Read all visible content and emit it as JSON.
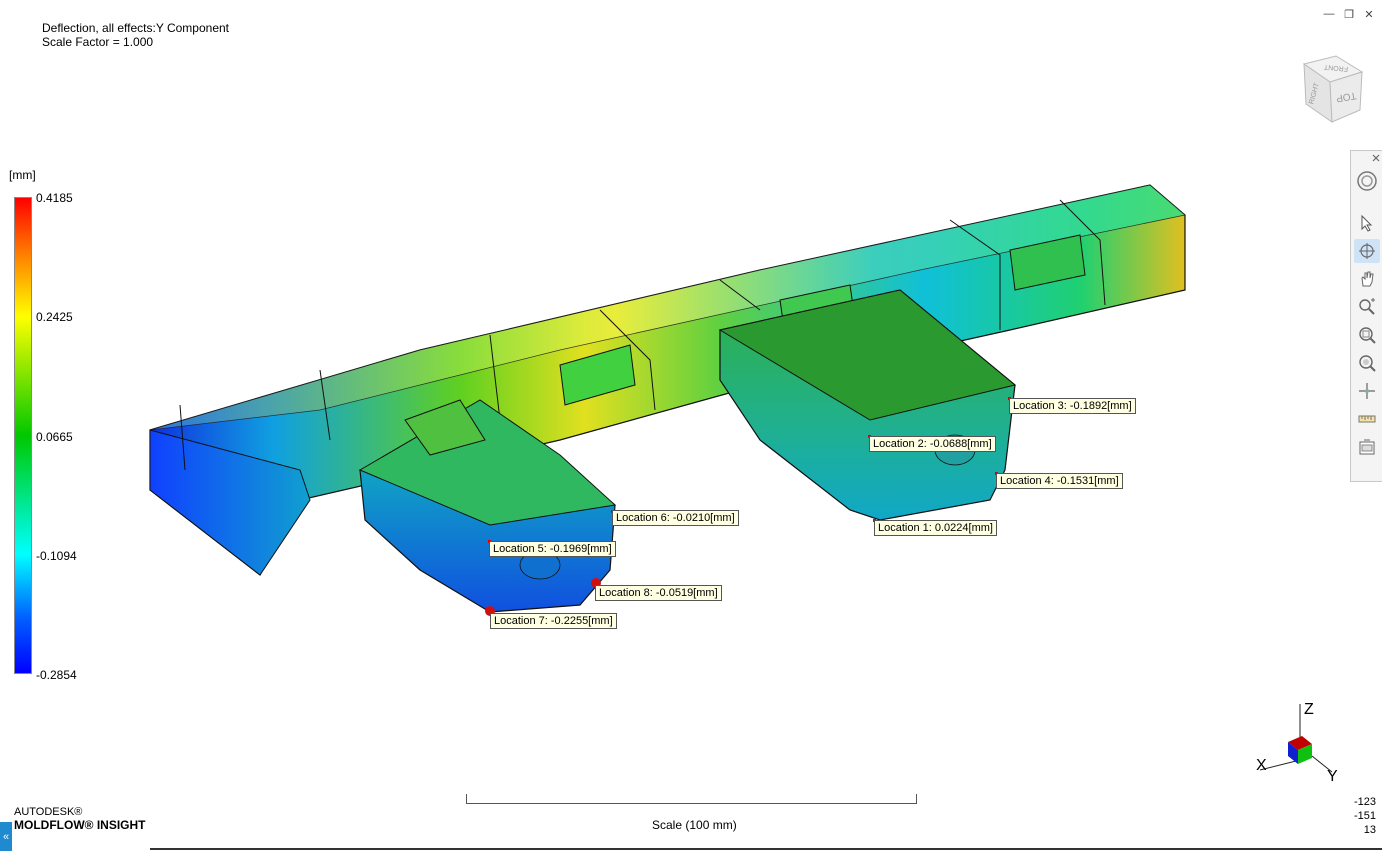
{
  "header": {
    "title": "Deflection, all effects:Y Component",
    "scale_factor": "Scale Factor = 1.000"
  },
  "legend": {
    "unit": "[mm]",
    "ticks": [
      "0.4185",
      "0.2425",
      "0.0665",
      "-0.1094",
      "-0.2854"
    ],
    "colors": [
      "#ff0000",
      "#ffff00",
      "#00c800",
      "#00ffff",
      "#0000ff"
    ]
  },
  "probes": [
    {
      "label": "Location 1:  0.0224[mm]"
    },
    {
      "label": "Location 2: -0.0688[mm]"
    },
    {
      "label": "Location 3: -0.1892[mm]"
    },
    {
      "label": "Location 4: -0.1531[mm]"
    },
    {
      "label": "Location 5: -0.1969[mm]"
    },
    {
      "label": "Location 6: -0.0210[mm]"
    },
    {
      "label": "Location 7: -0.2255[mm]"
    },
    {
      "label": "Location 8: -0.0519[mm]"
    }
  ],
  "viewcube": {
    "faces": [
      "FRONT",
      "RIGHT",
      "TOP"
    ]
  },
  "axes": {
    "z": "Z",
    "x": "X",
    "y": "Y"
  },
  "branding": {
    "line1": "AUTODESK®",
    "line2": "MOLDFLOW® INSIGHT"
  },
  "scale": {
    "label": "Scale (100 mm)"
  },
  "coords": {
    "x": "-123",
    "y": "-151",
    "z": "13"
  },
  "window": {
    "minimize": "—",
    "restore": "❐",
    "close": "✕"
  },
  "side_tab": {
    "glyph": "«"
  }
}
